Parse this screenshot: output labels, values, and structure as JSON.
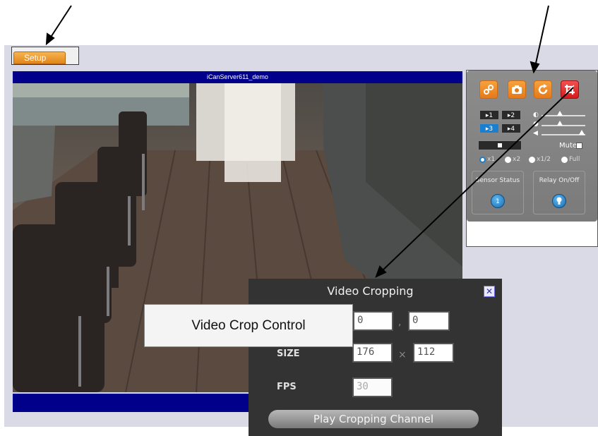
{
  "setup_tab": {
    "label": "Setup"
  },
  "video": {
    "title": "iCanServer611_demo"
  },
  "control_panel": {
    "tool_buttons": [
      "link-icon",
      "camera-icon",
      "refresh-icon",
      "crop-icon"
    ],
    "channels": [
      {
        "label": "▸1",
        "active": false
      },
      {
        "label": "▸2",
        "active": false
      },
      {
        "label": "▸3",
        "active": true
      },
      {
        "label": "▸4",
        "active": false
      }
    ],
    "mute_label": "Mute",
    "zoom_options": [
      {
        "label": "x1",
        "selected": true
      },
      {
        "label": "x2",
        "selected": false
      },
      {
        "label": "x1/2",
        "selected": false
      },
      {
        "label": "Full",
        "selected": false
      }
    ],
    "sensor_status_label": "Sensor Status",
    "sensor_value": "1",
    "relay_label": "Relay On/Off"
  },
  "crop_dialog": {
    "title": "Video Cropping",
    "offset_x": "0",
    "offset_y": "0",
    "offset_sep": ",",
    "size_label": "SIZE",
    "width": "176",
    "height": "112",
    "size_sep": "×",
    "fps_label": "FPS",
    "fps": "30",
    "play_button": "Play Cropping Channel"
  },
  "callout": {
    "text": "Video Crop Control"
  },
  "colors": {
    "accent_orange": "#e5791a",
    "title_bar_blue": "#00008b",
    "crop_red": "#d31c1c",
    "channel_active_blue": "#1b7fd0"
  }
}
